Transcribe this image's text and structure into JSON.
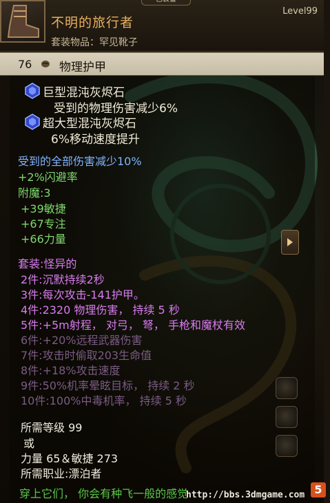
{
  "header": {
    "top_tab": "已装备",
    "item_name": "不明的旅行者",
    "subtitle": "套装物品：罕见靴子",
    "level": "Level99"
  },
  "defense": {
    "value": "76",
    "icon": "armor-fist-icon",
    "label": "物理护甲"
  },
  "gems": [
    {
      "name": "巨型混沌灰烬石",
      "effect": "受到的物理伤害减少6%",
      "icon": "blue-gem-icon"
    },
    {
      "name": "超大型混沌灰烬石",
      "effect": "6%移动速度提升",
      "icon": "blue-gem-icon"
    }
  ],
  "stats": {
    "damage_reduction": "受到的全部伤害减少10%",
    "dodge": "+2%闪避率",
    "enchant": "附魔:3",
    "agility": "+39敏捷",
    "focus": "+67专注",
    "strength": "+66力量"
  },
  "set_bonus": {
    "title": "套装:怪异的",
    "active": [
      "2件:沉默持续2秒",
      "3件:每次攻击-141护甲。",
      "4件:2320 物理伤害， 持续 5 秒",
      "5件:+5m射程， 对弓， 弩， 手枪和魔杖有效"
    ],
    "inactive": [
      "6件:+20%远程武器伤害",
      "7件:攻击时偷取203生命值",
      "8件:+18%攻击速度",
      "9件:50%机率晕眩目标， 持续 2 秒",
      "10件:100%中毒机率， 持续 5 秒"
    ]
  },
  "requirements": {
    "level": "所需等级 99",
    "or": "或",
    "attributes": "力量 65＆敏捷 273",
    "class": "所需职业:漂泊者"
  },
  "flavor": "穿上它们， 你会有种飞一般的感觉",
  "watermark": "http://bbs.3dmgame.com",
  "logo_text": "5",
  "colors": {
    "item_name": "#e8b060",
    "stat_blue": "#7fb4ff",
    "stat_green": "#7ed86e",
    "set_active": "#d87cf0",
    "set_inactive": "#7a5c84",
    "flavor": "#58c848"
  }
}
